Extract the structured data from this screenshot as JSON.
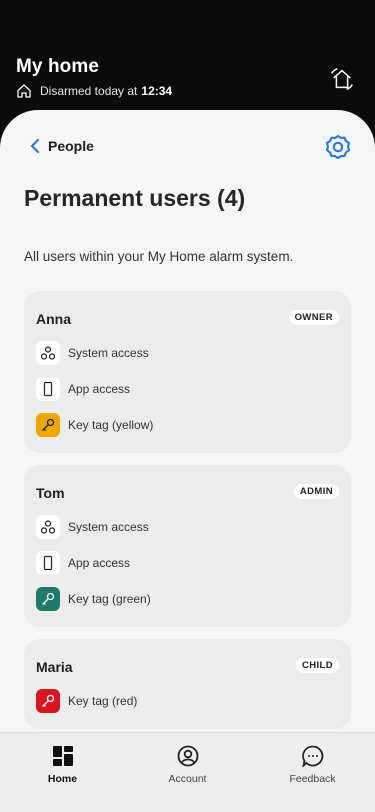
{
  "header": {
    "title": "My home",
    "status_prefix": "Disarmed today at",
    "status_time": "12:34"
  },
  "nav": {
    "back_label": "People"
  },
  "page": {
    "title": "Permanent users (4)",
    "subtitle": "All users within your My Home alarm system."
  },
  "users": [
    {
      "name": "Anna",
      "role": "OWNER",
      "permissions": [
        {
          "label": "System access",
          "icon": "system-icon"
        },
        {
          "label": "App access",
          "icon": "phone-icon"
        },
        {
          "label": "Key tag (yellow)",
          "icon": "key-icon",
          "color": "#f0a800"
        }
      ]
    },
    {
      "name": "Tom",
      "role": "ADMIN",
      "permissions": [
        {
          "label": "System access",
          "icon": "system-icon"
        },
        {
          "label": "App access",
          "icon": "phone-icon"
        },
        {
          "label": "Key tag (green)",
          "icon": "key-icon",
          "color": "#1e7a6a"
        }
      ]
    },
    {
      "name": "Maria",
      "role": "CHILD",
      "permissions": [
        {
          "label": "Key tag (red)",
          "icon": "key-icon",
          "color": "#d81620"
        }
      ]
    }
  ],
  "tabs": [
    {
      "label": "Home",
      "icon": "grid-icon",
      "active": true
    },
    {
      "label": "Account",
      "icon": "account-icon",
      "active": false
    },
    {
      "label": "Feedback",
      "icon": "feedback-icon",
      "active": false
    }
  ],
  "colors": {
    "accent": "#2d7bd8",
    "key_yellow": "#f0a800",
    "key_green": "#1e7a6a",
    "key_red": "#d81620"
  }
}
